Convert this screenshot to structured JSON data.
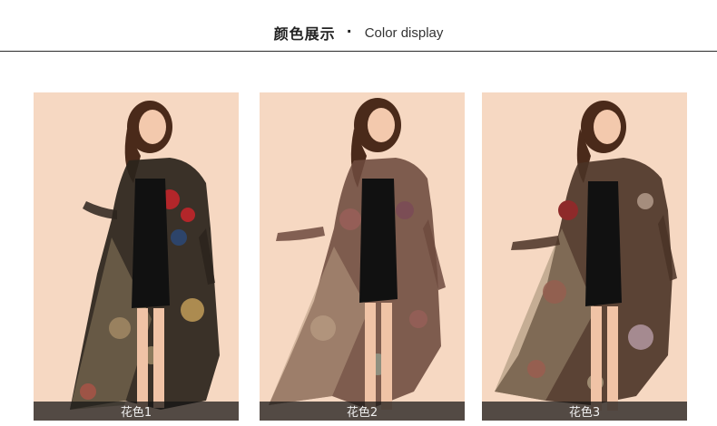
{
  "header": {
    "title_cn": "颜色展示",
    "separator": "·",
    "title_en": "Color display"
  },
  "products": [
    {
      "caption": "花色1",
      "icon": "model-photo-icon",
      "colors": {
        "background": "#f6d8c2",
        "robe": "#2b231c",
        "accent": "#b3262a",
        "sheer": "#8c7a5c",
        "dress": "#111111"
      }
    },
    {
      "caption": "花色2",
      "icon": "model-photo-icon",
      "colors": {
        "background": "#f6d8c2",
        "robe": "#6d4a3e",
        "accent": "#9b5f5a",
        "sheer": "#b79a82",
        "dress": "#111111"
      }
    },
    {
      "caption": "花色3",
      "icon": "model-photo-icon",
      "colors": {
        "background": "#f6d8c2",
        "robe": "#4a3326",
        "accent": "#8e2a2a",
        "sheer": "#9d8a70",
        "dress": "#111111"
      }
    }
  ],
  "colors": {
    "page_bg": "#ffffff",
    "title_text": "#222222",
    "rule": "#2a2a2a",
    "caption_bg": "#141414",
    "caption_text": "#f0f0f0"
  }
}
